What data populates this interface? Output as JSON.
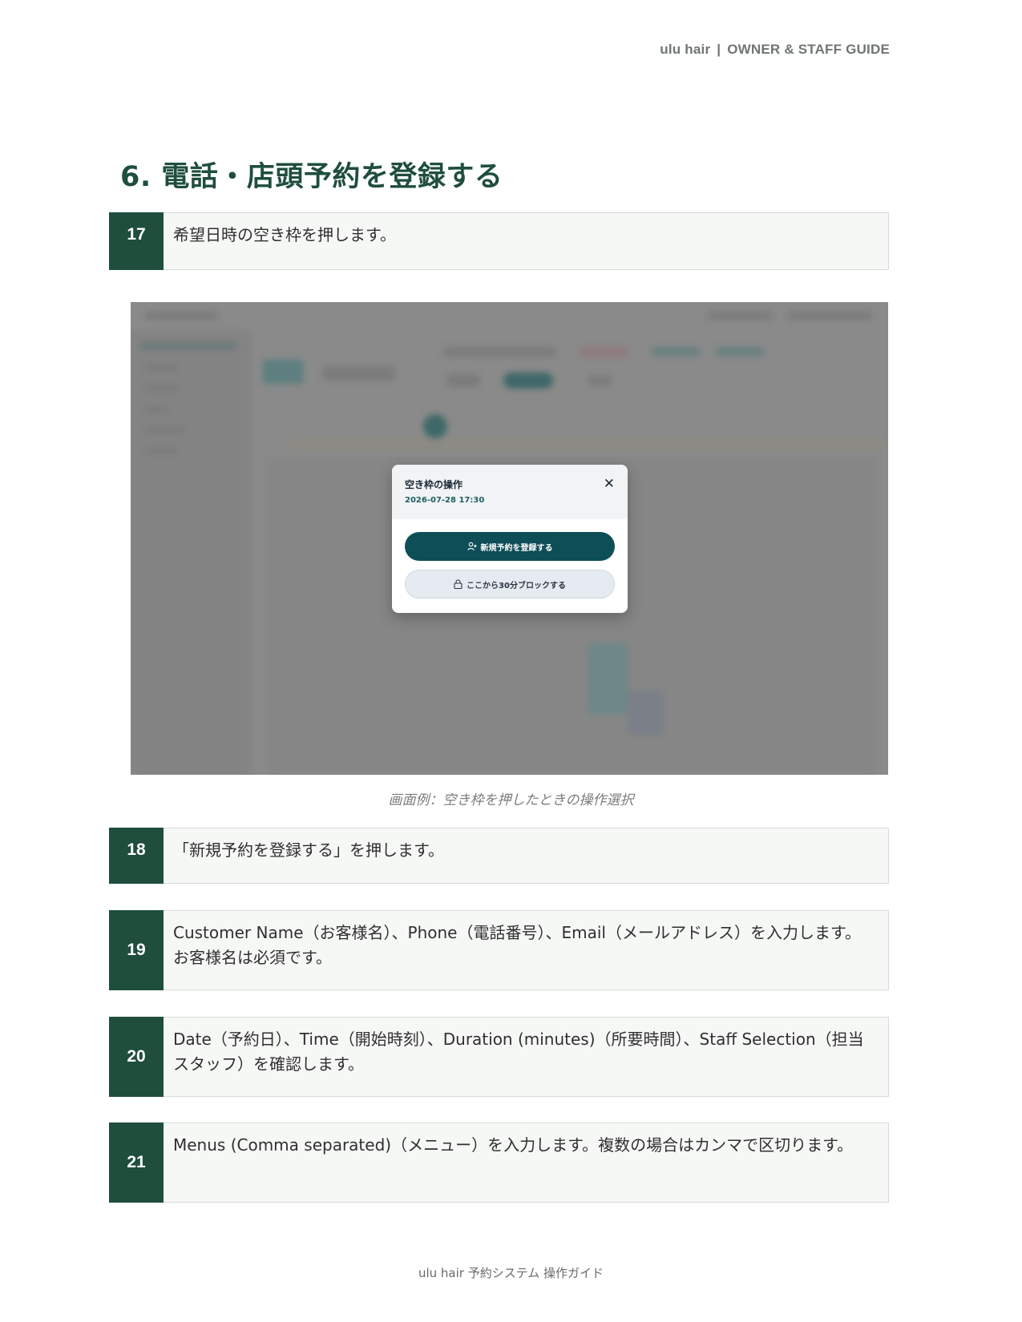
{
  "header": {
    "brand": "ulu hair",
    "separator": "|",
    "guide": "OWNER & STAFF GUIDE"
  },
  "section_title": "6. 電話・店頭予約を登録する",
  "steps": [
    {
      "number": "17",
      "text": "希望日時の空き枠を押します。"
    },
    {
      "number": "18",
      "text": "「新規予約を登録する」を押します。"
    },
    {
      "number": "19",
      "text": "Customer Name（お客様名）、Phone（電話番号）、Email（メールアドレス）を入力します。お客様名は必須です。"
    },
    {
      "number": "20",
      "text": "Date（予約日）、Time（開始時刻）、Duration (minutes)（所要時間）、Staff Selection（担当スタッフ）を確認します。"
    },
    {
      "number": "21",
      "text": "Menus (Comma separated)（メニュー）を入力します。複数の場合はカンマで区切ります。"
    }
  ],
  "screenshot": {
    "modal": {
      "title": "空き枠の操作",
      "datetime": "2026-07-28 17:30",
      "close_icon": "close-icon",
      "primary_button": "新規予約を登録する",
      "primary_icon": "user-plus-icon",
      "secondary_button": "ここから30分ブロックする",
      "secondary_icon": "lock-icon"
    }
  },
  "caption": "画面例：空き枠を押したときの操作選択",
  "footer": "ulu hair 予約システム 操作ガイド"
}
